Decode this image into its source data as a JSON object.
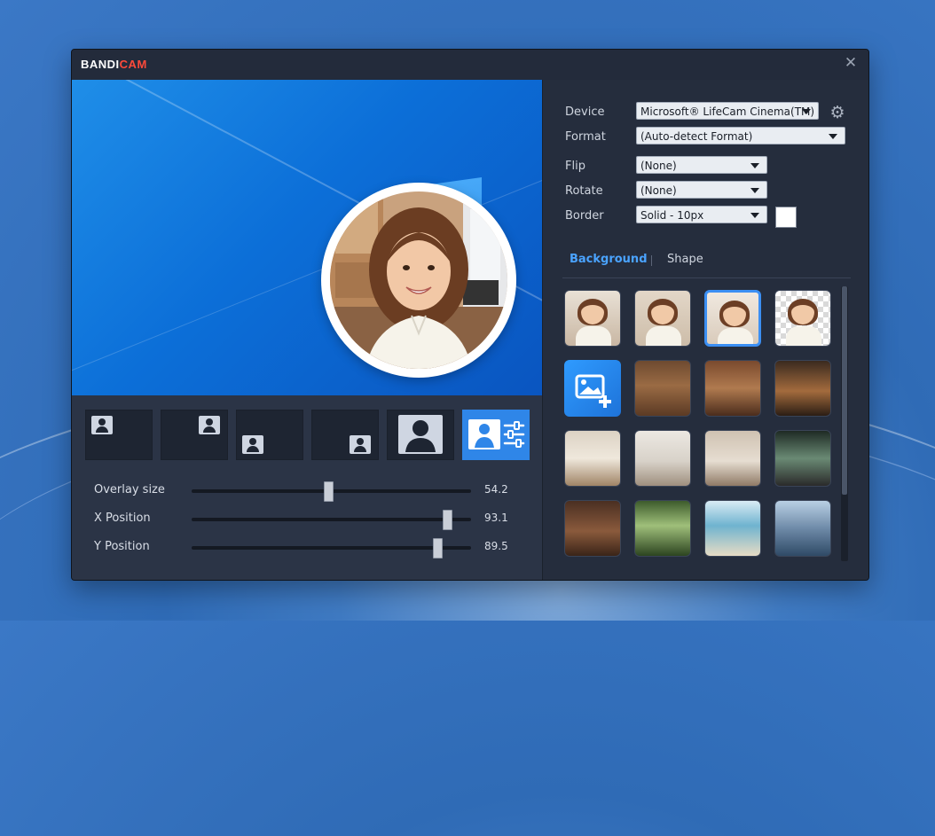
{
  "app": {
    "title_part1": "BANDI",
    "title_part2": "CAM",
    "close_glyph": "✕"
  },
  "settings": {
    "device_label": "Device",
    "device_value": "Microsoft® LifeCam Cinema(TM)",
    "format_label": "Format",
    "format_value": "(Auto-detect Format)",
    "flip_label": "Flip",
    "flip_value": "(None)",
    "rotate_label": "Rotate",
    "rotate_value": "(None)",
    "border_label": "Border",
    "border_value": "Solid - 10px",
    "border_color": "#FFFFFF",
    "settings_icon": "gear-icon"
  },
  "tabs": [
    {
      "label": "Background",
      "active": true
    },
    {
      "label": "Shape",
      "active": false
    }
  ],
  "sliders": [
    {
      "label": "Overlay size",
      "value": "54.2",
      "fraction": 0.49
    },
    {
      "label": "X Position",
      "value": "93.1",
      "fraction": 0.915
    },
    {
      "label": "Y Position",
      "value": "89.5",
      "fraction": 0.88
    }
  ],
  "layouts": [
    {
      "name": "layout-top-left"
    },
    {
      "name": "layout-top-right"
    },
    {
      "name": "layout-bottom-left"
    },
    {
      "name": "layout-bottom-right"
    },
    {
      "name": "layout-full"
    },
    {
      "name": "layout-custom",
      "selected": true
    }
  ],
  "backgrounds": [
    {
      "name": "bg-original-room",
      "type": "person"
    },
    {
      "name": "bg-blur",
      "type": "person"
    },
    {
      "name": "bg-soft-blur",
      "type": "person",
      "selected": true
    },
    {
      "name": "bg-transparent",
      "type": "person"
    },
    {
      "name": "bg-add-image",
      "type": "add"
    },
    {
      "name": "bg-office-desk",
      "type": "scene"
    },
    {
      "name": "bg-library",
      "type": "scene"
    },
    {
      "name": "bg-cafe",
      "type": "scene"
    },
    {
      "name": "bg-sunny-room",
      "type": "scene"
    },
    {
      "name": "bg-living-room",
      "type": "scene"
    },
    {
      "name": "bg-bedroom",
      "type": "scene"
    },
    {
      "name": "bg-window-view",
      "type": "scene"
    },
    {
      "name": "bg-loft",
      "type": "scene"
    },
    {
      "name": "bg-forest",
      "type": "scene"
    },
    {
      "name": "bg-beach",
      "type": "scene"
    },
    {
      "name": "bg-lake-mountains",
      "type": "scene"
    }
  ],
  "colors": {
    "accent": "#2F86E8",
    "tab_active": "#4AA3FF",
    "panel_bg": "#252D3D"
  }
}
